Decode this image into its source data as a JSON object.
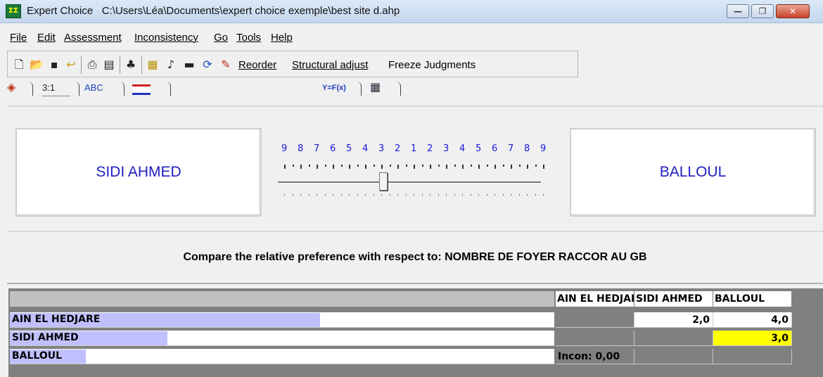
{
  "window": {
    "app_name": "Expert Choice",
    "file_path": "C:\\Users\\Léa\\Documents\\expert choice exemple\\best site d.ahp",
    "app_icon_text": "ΣΣ",
    "minimize": "—",
    "maximize": "❐",
    "close": "✕"
  },
  "menu": [
    "File",
    "Edit",
    "Assessment",
    "Inconsistency",
    "Go",
    "Tools",
    "Help"
  ],
  "toolbar": {
    "icons": [
      "new-file-icon",
      "open-folder-icon",
      "save-icon",
      "undo-icon",
      "print-icon",
      "print-preview-icon",
      "tree-view-icon",
      "calculator-icon",
      "music-note-icon",
      "rectangle-icon",
      "refresh-icon",
      "magic-wand-icon"
    ],
    "reorder": "Reorder",
    "structural_adjust": "Structural adjust",
    "freeze_judgments": "Freeze Judgments"
  },
  "tabs": {
    "verbal": "",
    "numerical": "3:1",
    "text": "ABC",
    "graphical": "",
    "formula": "Y=F(x)",
    "matrix": ""
  },
  "comparison": {
    "left": "SIDI AHMED",
    "right": "BALLOUL",
    "scale": [
      "9",
      "8",
      "7",
      "6",
      "5",
      "4",
      "3",
      "2",
      "1",
      "2",
      "3",
      "4",
      "5",
      "6",
      "7",
      "8",
      "9"
    ],
    "slider_value": 3,
    "slider_side": "right"
  },
  "criterion": "Compare the relative preference  with respect to: NOMBRE DE FOYER RACCOR AU GB",
  "matrix": {
    "columns": [
      "AIN EL HEDJARE",
      "SIDI AHMED",
      "BALLOUL"
    ],
    "rows": [
      {
        "label": "AIN EL HEDJARE",
        "bar": 0.57,
        "cells": [
          "",
          "2,0",
          "4,0"
        ]
      },
      {
        "label": "SIDI AHMED",
        "bar": 0.29,
        "cells": [
          "",
          "",
          "3,0"
        ]
      },
      {
        "label": "BALLOUL",
        "bar": 0.14,
        "cells": [
          "Incon: 0,00",
          "",
          ""
        ]
      }
    ],
    "highlight_color": "#ffff00",
    "bar_color": "#c0c0ff"
  }
}
